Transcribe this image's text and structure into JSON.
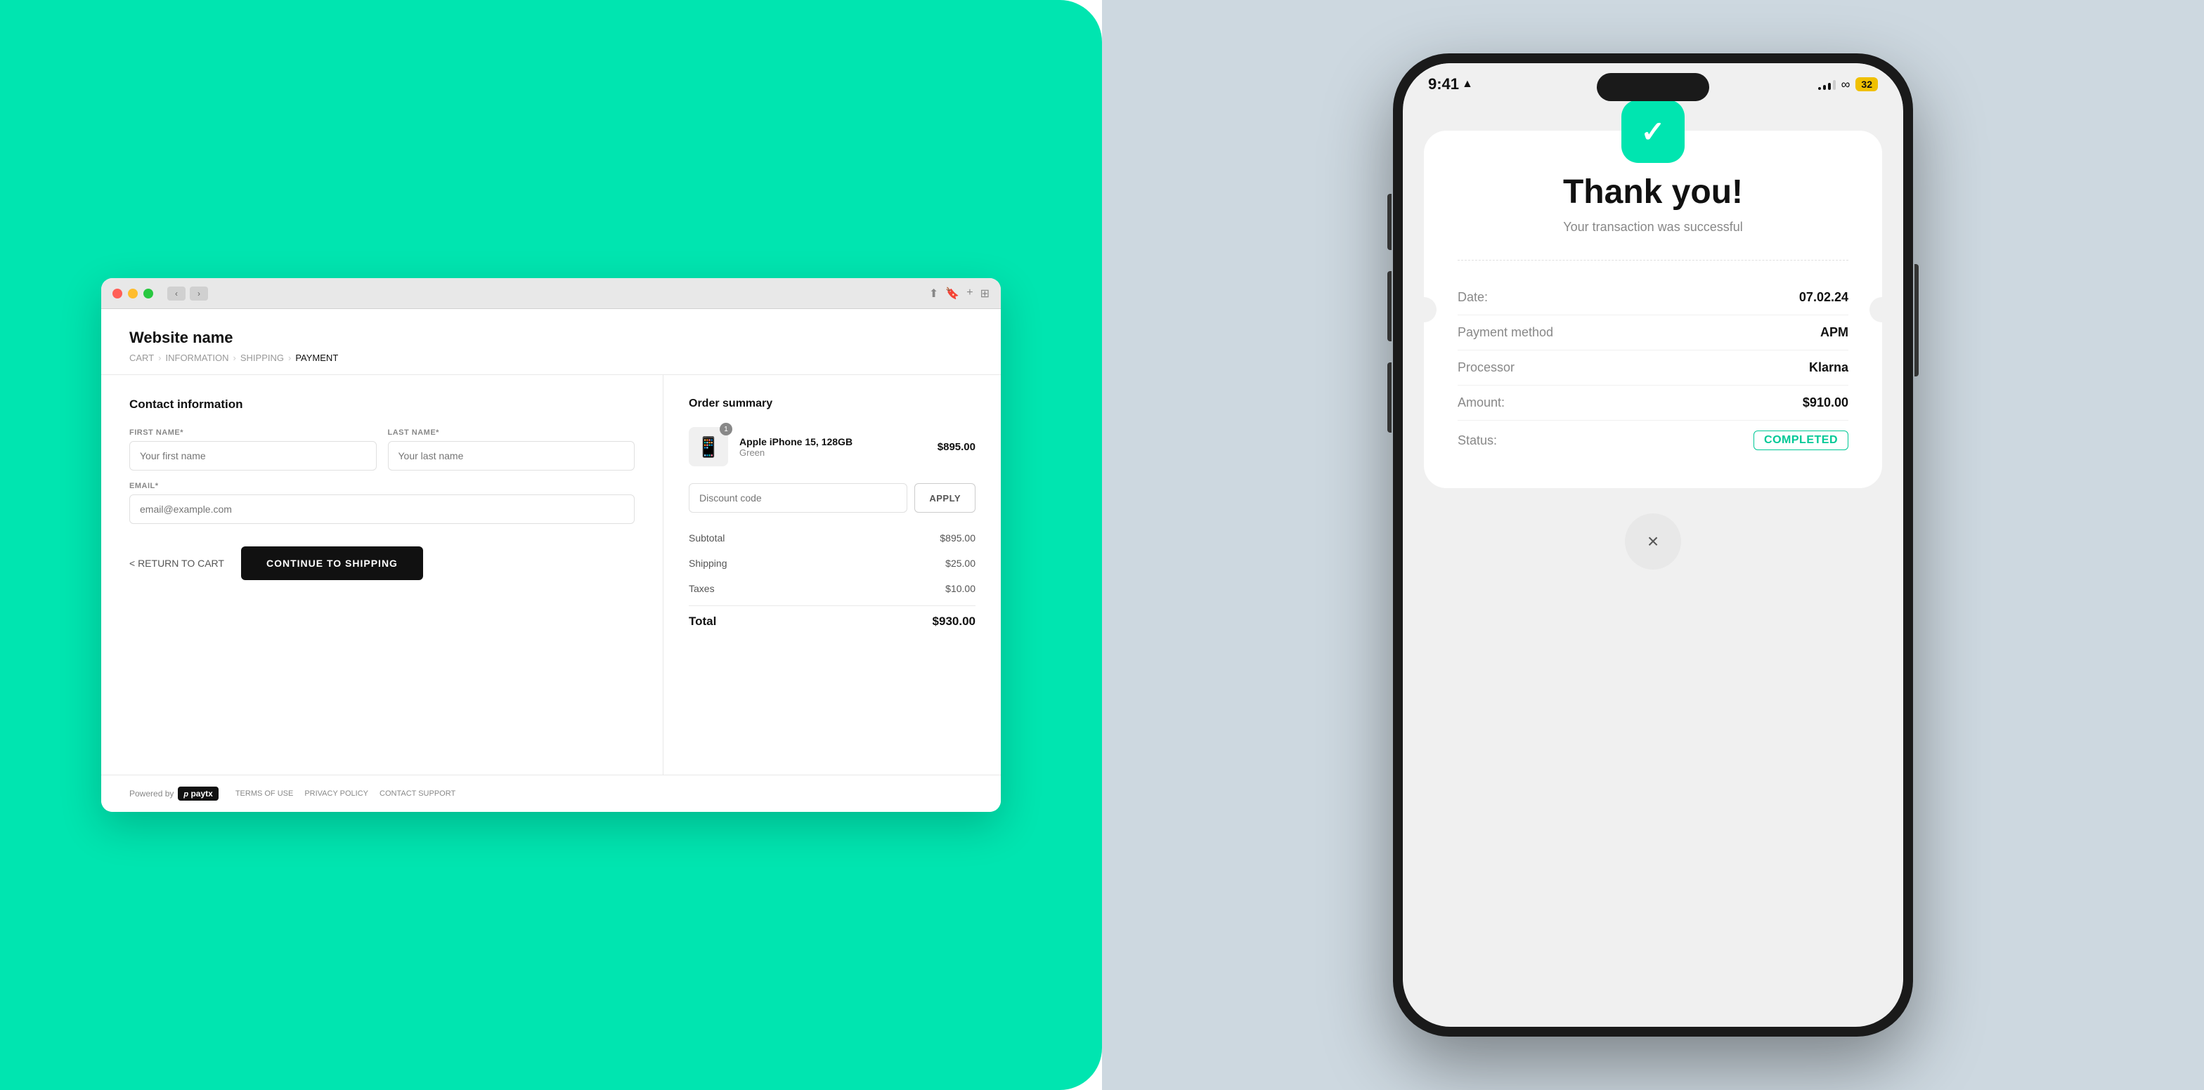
{
  "left": {
    "browser": {
      "dots": [
        "red",
        "yellow",
        "green"
      ],
      "site_name": "Website name",
      "breadcrumb": {
        "items": [
          "CART",
          "INFORMATION",
          "SHIPPING",
          "PAYMENT"
        ],
        "separators": [
          ">",
          ">",
          ">"
        ]
      },
      "contact_section": {
        "title": "Contact information",
        "first_name_label": "FIRST NAME*",
        "first_name_placeholder": "Your first name",
        "last_name_label": "LAST NAME*",
        "last_name_placeholder": "Your last name",
        "email_label": "EMAIL*",
        "email_placeholder": "email@example.com"
      },
      "actions": {
        "return_label": "< RETURN TO CART",
        "continue_label": "CONTINUE TO SHIPPING"
      },
      "order_summary": {
        "title": "Order summary",
        "product": {
          "name": "Apple iPhone 15, 128GB",
          "variant": "Green",
          "price": "$895.00",
          "badge": "1",
          "emoji": "📱"
        },
        "discount_placeholder": "Discount code",
        "apply_label": "APPLY",
        "lines": [
          {
            "label": "Subtotal",
            "value": "$895.00"
          },
          {
            "label": "Shipping",
            "value": "$25.00"
          },
          {
            "label": "Taxes",
            "value": "$10.00"
          }
        ],
        "total_label": "Total",
        "total_value": "$930.00"
      },
      "footer": {
        "powered_by": "Powered by",
        "brand": "paytx",
        "links": [
          "TERMS OF USE",
          "PRIVACY POLICY",
          "CONTACT SUPPORT"
        ]
      }
    }
  },
  "right": {
    "phone": {
      "status_bar": {
        "time": "9:41",
        "location_icon": "▲",
        "signal_bars": [
          3,
          6,
          9,
          12
        ],
        "battery_value": "32"
      },
      "transaction": {
        "check_icon": "✓",
        "title": "Thank you!",
        "subtitle": "Your transaction was successful",
        "details": [
          {
            "label": "Date:",
            "value": "07.02.24"
          },
          {
            "label": "Payment method",
            "value": "APM"
          },
          {
            "label": "Processor",
            "value": "Klarna"
          },
          {
            "label": "Amount:",
            "value": "$910.00"
          },
          {
            "label": "Status:",
            "value": "COMPLETED",
            "status": true
          }
        ]
      },
      "close_icon": "×"
    }
  }
}
